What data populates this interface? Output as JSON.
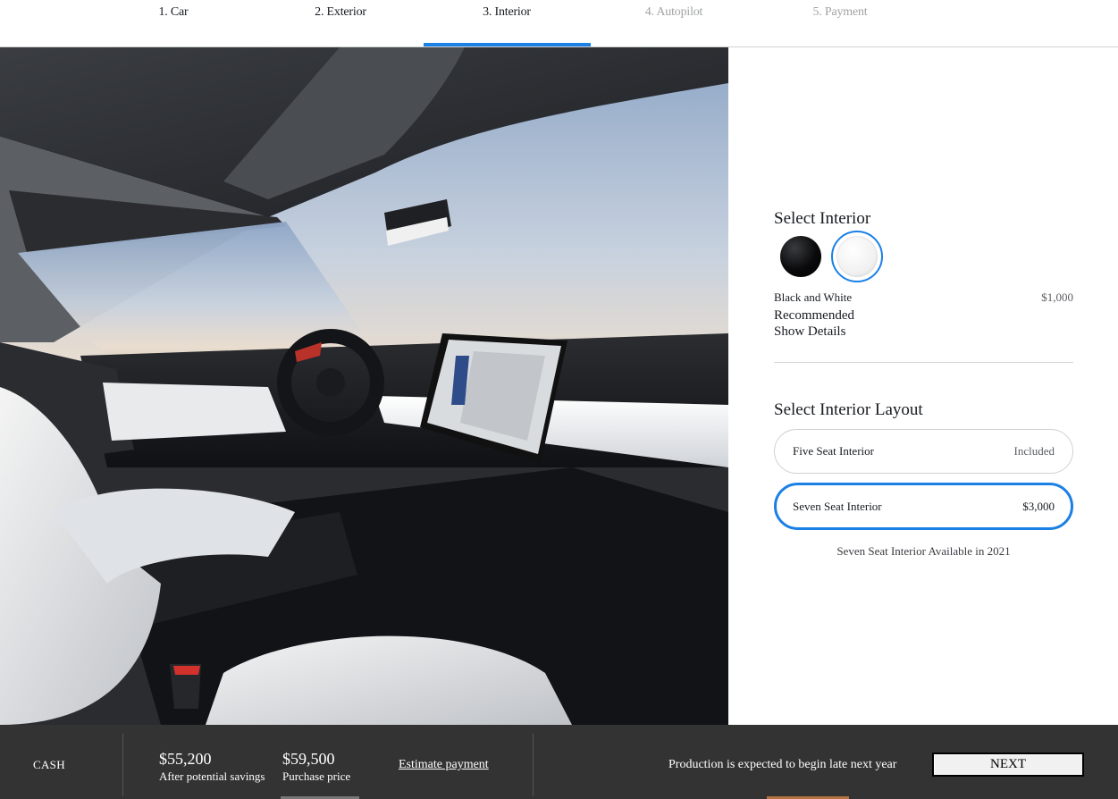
{
  "steps": [
    {
      "label": "1. Car",
      "state": "done"
    },
    {
      "label": "2. Exterior",
      "state": "done"
    },
    {
      "label": "3. Interior",
      "state": "active"
    },
    {
      "label": "4. Autopilot",
      "state": "disabled"
    },
    {
      "label": "5. Payment",
      "state": "disabled"
    }
  ],
  "hero": {
    "image": "car-interior-photo"
  },
  "interior": {
    "title": "Select Interior",
    "swatches": [
      {
        "name": "black-swatch",
        "color": "#0b0b0d",
        "selected": false
      },
      {
        "name": "white-swatch",
        "color": "#f4f4f4",
        "selected": true
      }
    ],
    "selected_name": "Black and White",
    "selected_price": "$1,000",
    "recommended": "Recommended",
    "show_details": "Show Details"
  },
  "layout": {
    "title": "Select Interior Layout",
    "options": [
      {
        "label": "Five Seat Interior",
        "price": "Included",
        "selected": false
      },
      {
        "label": "Seven Seat Interior",
        "price": "$3,000",
        "selected": true
      }
    ],
    "note": "Seven Seat Interior Available in 2021"
  },
  "footer": {
    "payment_type": "CASH",
    "savings_price": "$55,200",
    "savings_label": "After potential savings",
    "purchase_price": "$59,500",
    "purchase_label": "Purchase price",
    "estimate_link": "Estimate payment",
    "production_note": "Production is expected to begin late next year",
    "next_label": "NEXT"
  },
  "colors": {
    "accent": "#1a80e6",
    "footer_bg": "#333333",
    "text": "#171a20",
    "disabled": "#a2a3a5"
  }
}
